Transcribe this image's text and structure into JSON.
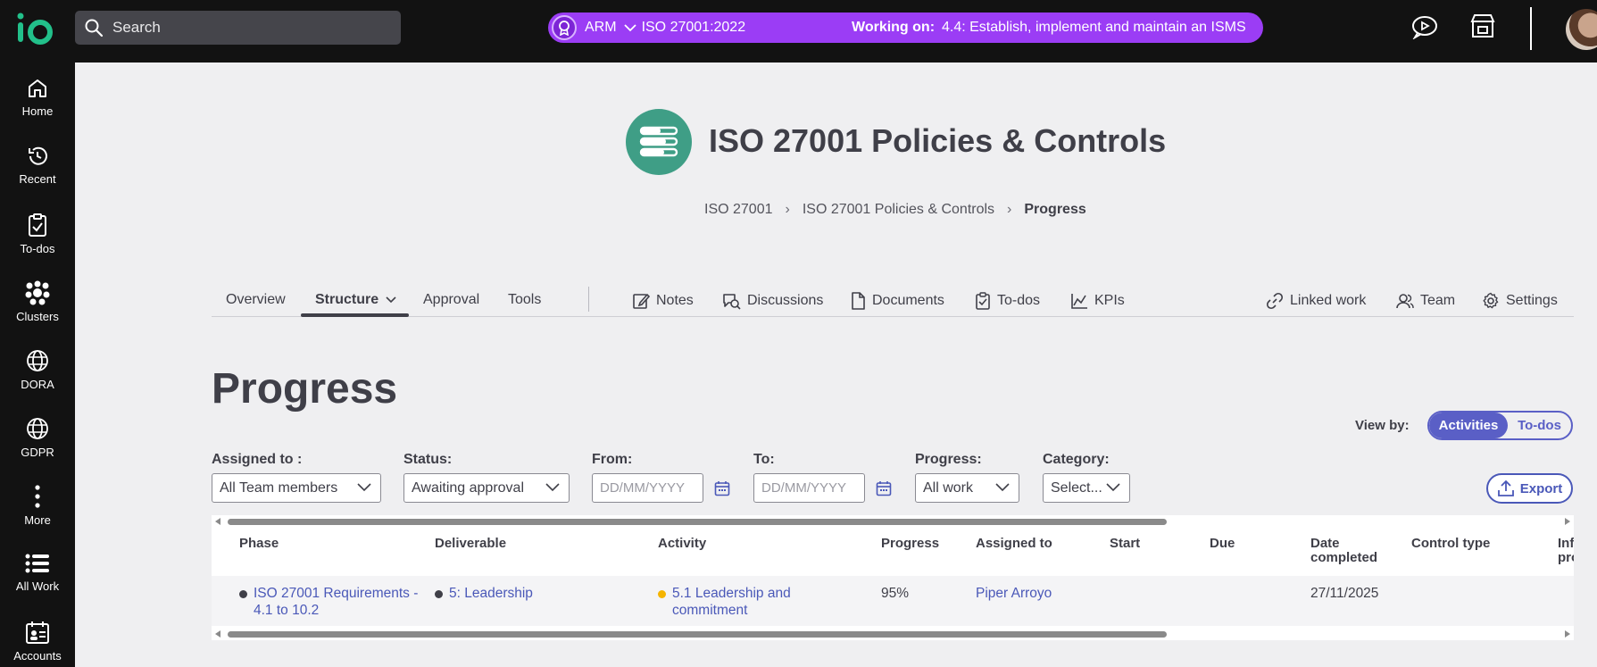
{
  "topbar": {
    "logo_text": "io",
    "search_placeholder": "Search",
    "project": {
      "code": "ARM",
      "standard": "ISO 27001:2022",
      "working_label": "Working on:",
      "working_task": "4.4: Establish, implement and maintain an ISMS",
      "color": "#9b3df5"
    }
  },
  "sidebar": {
    "items": [
      {
        "label": "Home",
        "icon": "home-icon"
      },
      {
        "label": "Recent",
        "icon": "history-icon"
      },
      {
        "label": "To-dos",
        "icon": "clipboard-check-icon"
      },
      {
        "label": "Clusters",
        "icon": "clusters-icon"
      },
      {
        "label": "DORA",
        "icon": "globe-icon"
      },
      {
        "label": "GDPR",
        "icon": "globe-icon"
      },
      {
        "label": "More",
        "icon": "more-vertical-icon"
      },
      {
        "label": "All Work",
        "icon": "list-icon"
      },
      {
        "label": "Accounts",
        "icon": "accounts-icon"
      }
    ]
  },
  "header": {
    "title": "ISO 27001 Policies & Controls",
    "icon_color": "#3f9e86",
    "breadcrumb": [
      "ISO 27001",
      "ISO 27001 Policies & Controls",
      "Progress"
    ]
  },
  "tabs": {
    "overview": "Overview",
    "structure": "Structure",
    "approval": "Approval",
    "tools": "Tools",
    "notes": "Notes",
    "discussions": "Discussions",
    "documents": "Documents",
    "todos": "To-dos",
    "kpis": "KPIs",
    "linked_work": "Linked work",
    "team": "Team",
    "settings": "Settings"
  },
  "page": {
    "heading": "Progress",
    "view_by_label": "View by:",
    "view_by_options": [
      "Activities",
      "To-dos"
    ],
    "view_by_selected": "Activities",
    "export_label": "Export"
  },
  "filters": {
    "assigned_label": "Assigned to :",
    "assigned_value": "All Team members",
    "status_label": "Status:",
    "status_value": "Awaiting approval",
    "from_label": "From:",
    "from_placeholder": "DD/MM/YYYY",
    "to_label": "To:",
    "to_placeholder": "DD/MM/YYYY",
    "progress_label": "Progress:",
    "progress_value": "All work",
    "category_label": "Category:",
    "category_value": "Select..."
  },
  "table": {
    "columns": [
      "Phase",
      "Deliverable",
      "Activity",
      "Progress",
      "Assigned to",
      "Start",
      "Due",
      "Date\ncompleted",
      "Control type",
      "Inf\npro"
    ],
    "rows": [
      {
        "phase": "ISO 27001 Requirements - 4.1 to 10.2",
        "deliverable": "5: Leadership",
        "activity": "5.1 Leadership and commitment",
        "activity_status_color": "#f5b400",
        "progress": "95%",
        "assigned_to": "Piper Arroyo",
        "start": "",
        "due": "",
        "date_completed": "27/11/2025",
        "control_type": ""
      }
    ]
  }
}
